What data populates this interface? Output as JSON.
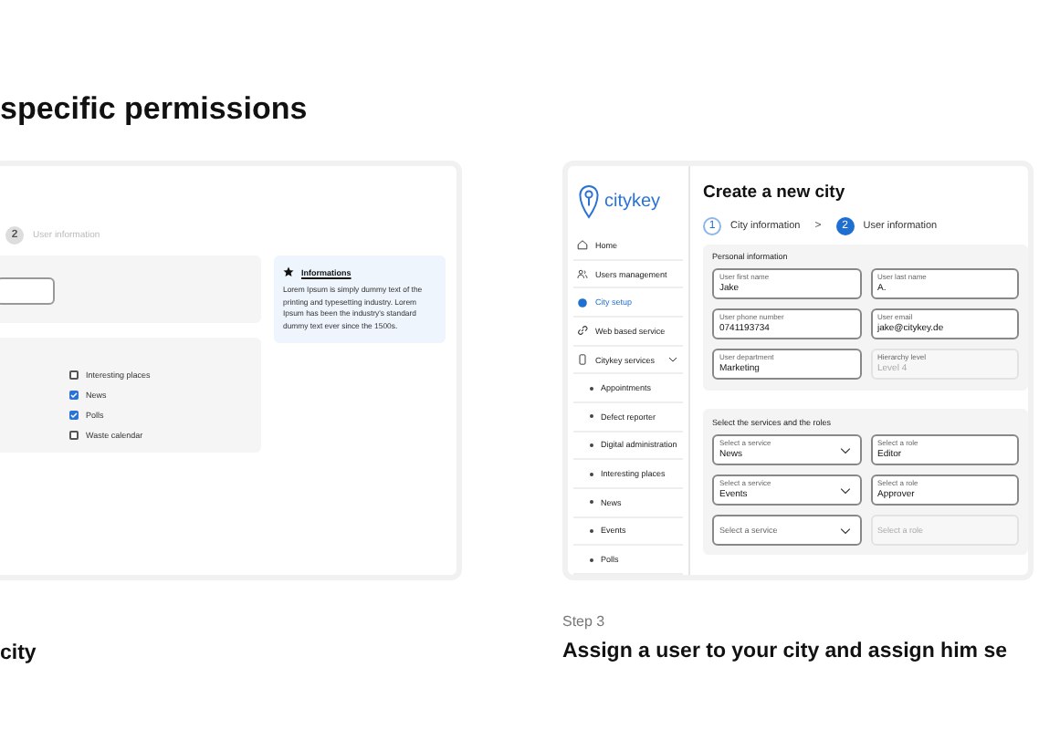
{
  "left_panel": {
    "heading": "specific permissions",
    "stepper": {
      "number": "2",
      "label": "User information",
      "selected": false
    },
    "checklist": [
      {
        "label": "Interesting places",
        "checked": false
      },
      {
        "label": "News",
        "checked": true
      },
      {
        "label": "Polls",
        "checked": true
      },
      {
        "label": "Waste calendar",
        "checked": false
      }
    ],
    "info": {
      "title": "Informations",
      "text": "Lorem Ipsum is simply dummy text of the printing and typesetting industry. Lorem Ipsum has been the industry's standard dummy text ever since the 1500s."
    },
    "caption": "city"
  },
  "right_panel": {
    "logo": "citykey",
    "sidebar": {
      "items": [
        {
          "label": "Home",
          "kind": "main",
          "selected": false
        },
        {
          "label": "Users management",
          "kind": "main",
          "selected": false
        },
        {
          "label": "City setup",
          "kind": "main",
          "selected": true
        },
        {
          "label": "Web based service",
          "kind": "main",
          "selected": false
        },
        {
          "label": "Citykey services",
          "kind": "main",
          "selected": false,
          "expanded": true
        },
        {
          "label": "Appointments",
          "kind": "sub",
          "selected": false
        },
        {
          "label": "Defect reporter",
          "kind": "sub",
          "selected": false
        },
        {
          "label": "Digital administration",
          "kind": "sub",
          "selected": false
        },
        {
          "label": "Interesting places",
          "kind": "sub",
          "selected": false
        },
        {
          "label": "News",
          "kind": "sub",
          "selected": false
        },
        {
          "label": "Events",
          "kind": "sub",
          "selected": false
        },
        {
          "label": "Polls",
          "kind": "sub",
          "selected": false
        }
      ]
    },
    "title": "Create a new city",
    "steps": [
      {
        "number": "1",
        "label": "City information",
        "selected": false
      },
      {
        "number": "2",
        "label": "User information",
        "selected": true
      }
    ],
    "step_separator": ">",
    "personal": {
      "title": "Personal information",
      "fields": [
        {
          "label": "User first name",
          "value": "Jake",
          "disabled": false
        },
        {
          "label": "User last name",
          "value": "A.",
          "disabled": false
        },
        {
          "label": "User phone number",
          "value": "0741193734",
          "disabled": false
        },
        {
          "label": "User email",
          "value": "jake@citykey.de",
          "disabled": false
        },
        {
          "label": "User department",
          "value": "Marketing",
          "disabled": false
        },
        {
          "label": "Hierarchy level",
          "value": "Level 4",
          "disabled": true
        }
      ]
    },
    "services": {
      "title": "Select the services and the roles",
      "rows": [
        {
          "service": {
            "label": "Select a service",
            "value": "News"
          },
          "role": {
            "label": "Select a role",
            "value": "Editor",
            "disabled": false
          }
        },
        {
          "service": {
            "label": "Select a service",
            "value": "Events"
          },
          "role": {
            "label": "Select a role",
            "value": "Approver",
            "disabled": false
          }
        },
        {
          "service": {
            "placeholder": "Select a service"
          },
          "role": {
            "placeholder": "Select a role",
            "disabled": true
          }
        }
      ]
    },
    "step_label": "Step 3",
    "caption": "Assign a user to your city and assign him se"
  }
}
